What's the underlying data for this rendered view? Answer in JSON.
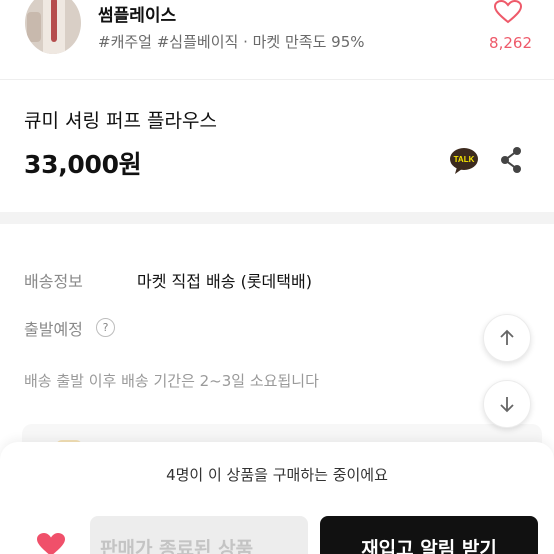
{
  "shop": {
    "name": "썸플레이스",
    "tags": "#캐주얼 #심플베이직 · 마켓 만족도 95%",
    "like_count": "8,262"
  },
  "product": {
    "title": "큐미 셔링 퍼프 플라우스",
    "price": "33,000원"
  },
  "icons": {
    "talk_label": "TALK"
  },
  "shipping": {
    "label": "배송정보",
    "value": "마켓 직접 배송 (롯데택배)",
    "depart_label": "출발예정",
    "help_glyph": "?",
    "note": "배송 출발 이후 배송 기간은 2~3일 소요됩니다"
  },
  "bottom": {
    "buyers_text": "4명이 이 상품을 구매하는 중이에요",
    "gray_button": "판매가 종료된 상품",
    "dark_button": "재입고 알림 받기"
  },
  "colors": {
    "accent_pink": "#ee5a6a",
    "fav_heart": "#f0506a",
    "talk_yellow": "#3c2a1e"
  }
}
